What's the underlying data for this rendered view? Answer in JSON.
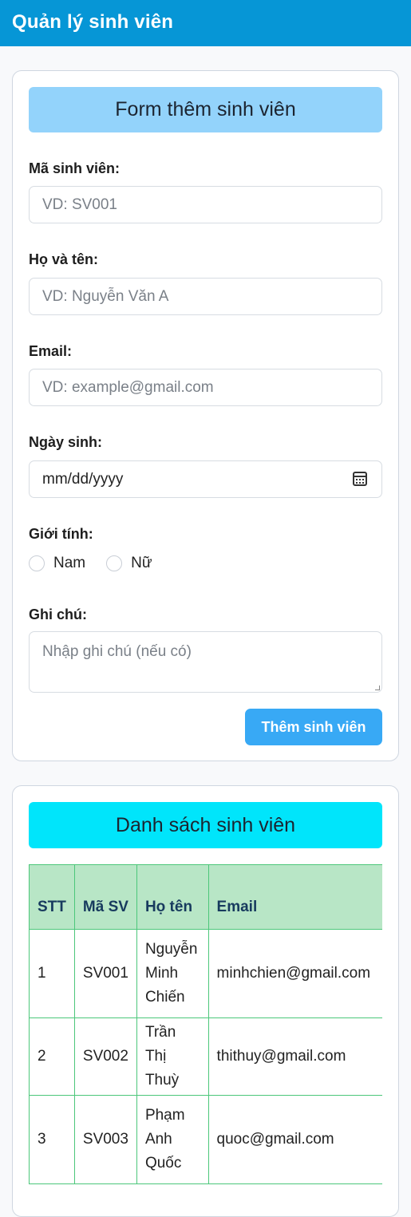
{
  "header": {
    "title": "Quản lý sinh viên"
  },
  "form": {
    "heading": "Form thêm sinh viên",
    "student_id": {
      "label": "Mã sinh viên:",
      "placeholder": "VD: SV001"
    },
    "full_name": {
      "label": "Họ và tên:",
      "placeholder": "VD: Nguyễn Văn A"
    },
    "email": {
      "label": "Email:",
      "placeholder": "VD: example@gmail.com"
    },
    "birthdate": {
      "label": "Ngày sinh:",
      "value": "mm/dd/yyyy",
      "icon": "calendar-icon"
    },
    "gender": {
      "label": "Giới tính:",
      "options": [
        "Nam",
        "Nữ"
      ]
    },
    "note": {
      "label": "Ghi chú:",
      "placeholder": "Nhập ghi chú (nếu có)"
    },
    "submit_label": "Thêm sinh viên"
  },
  "list": {
    "heading": "Danh sách sinh viên",
    "columns": [
      "STT",
      "Mã SV",
      "Họ tên",
      "Email"
    ],
    "rows": [
      {
        "stt": "1",
        "id": "SV001",
        "name": "Nguyễn Minh Chiến",
        "email": "minhchien@gmail.com"
      },
      {
        "stt": "2",
        "id": "SV002",
        "name": "Trần Thị Thuỳ",
        "email": "thithuy@gmail.com"
      },
      {
        "stt": "3",
        "id": "SV003",
        "name": "Phạm Anh Quốc",
        "email": "quoc@gmail.com"
      }
    ]
  },
  "colors": {
    "header_bg": "#0696d6",
    "form_head_bg": "#93d3fb",
    "list_head_bg": "#00e5fb",
    "button_bg": "#38a9f5",
    "table_head_bg": "#b8e6c6",
    "table_border": "#4cc77a"
  }
}
